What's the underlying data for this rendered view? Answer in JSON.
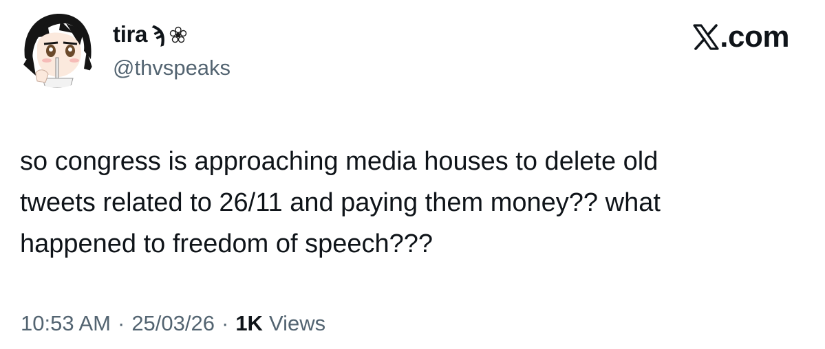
{
  "tweet": {
    "author": {
      "display_name": "tira",
      "display_name_glyph": "ϡ",
      "emoji_icon": "flower-icon",
      "handle": "@thvspeaks",
      "avatar": "anime-girl-avatar"
    },
    "brand": {
      "icon": "x-logo-icon",
      "suffix": ".com"
    },
    "text": "so congress is approaching media houses to delete old\ntweets related to 26/11 and paying them money?? what\nhappened to freedom of speech???",
    "time": "10:53 AM",
    "separator": "·",
    "date": "25/03/26",
    "views_count": "1K",
    "views_label": "Views"
  },
  "colors": {
    "text_primary": "#0f1419",
    "text_secondary": "#536471",
    "background": "#ffffff"
  }
}
